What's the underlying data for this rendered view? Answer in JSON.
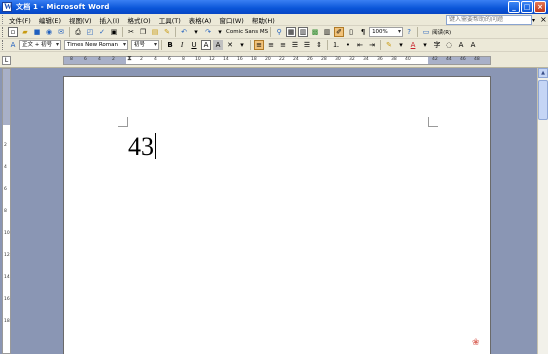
{
  "window": {
    "title": "文档 1 - Microsoft Word",
    "minimize": "_",
    "maximize": "□",
    "close": "×"
  },
  "menu": {
    "items": [
      "文件(F)",
      "编辑(E)",
      "视图(V)",
      "插入(I)",
      "格式(O)",
      "工具(T)",
      "表格(A)",
      "窗口(W)",
      "帮助(H)"
    ],
    "help_placeholder": "键入需要帮助的问题",
    "help_arrow": "▾",
    "close_doc": "×"
  },
  "toolbar_standard": {
    "font_preview": "Comic Sans MS",
    "zoom": "100%",
    "read_label": "阅读(R)"
  },
  "toolbar_format": {
    "style": "正文 + 初号",
    "font": "Times New Roman",
    "size": "初号",
    "bold": "B",
    "italic": "I",
    "underline": "U"
  },
  "ruler": {
    "corner": "L",
    "h_ticks": [
      "8",
      "6",
      "4",
      "2",
      "2",
      "4",
      "6",
      "8",
      "10",
      "12",
      "14",
      "16",
      "18",
      "20",
      "22",
      "24",
      "26",
      "28",
      "30",
      "32",
      "34",
      "36",
      "38",
      "40",
      "42",
      "44",
      "46",
      "48"
    ],
    "v_ticks": [
      "2",
      "4",
      "6",
      "8",
      "10",
      "12",
      "14",
      "16",
      "18"
    ]
  },
  "document": {
    "text": "43"
  },
  "colors": {
    "title_bar": "#0a55d8",
    "chrome": "#ece9d8",
    "workspace": "#8a96b4"
  }
}
